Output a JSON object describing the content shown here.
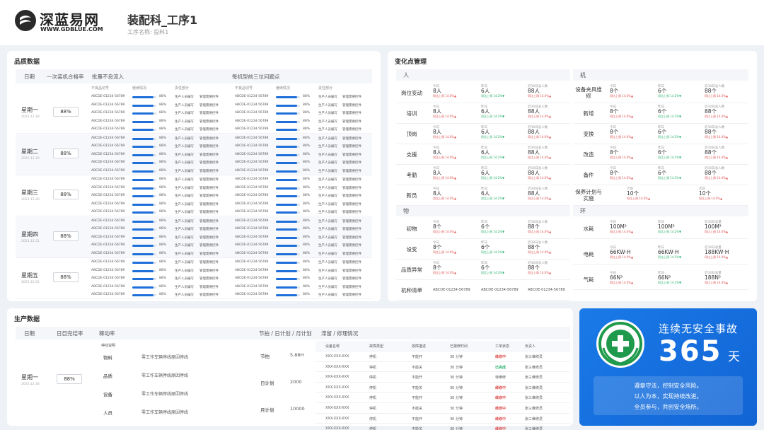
{
  "header": {
    "logo_cn": "深蓝易网",
    "logo_en": "WWW.GDBLUE.COM",
    "title": "装配科_工序1",
    "subtitle": "工序名称: 投料1"
  },
  "quality": {
    "title": "品质数据",
    "headers": [
      "日期",
      "一次装机合格率",
      "批量不良流入",
      "每机型前三位问题点"
    ],
    "subheaders": [
      "不良品切号",
      "继续情况",
      "责任部分",
      "不良品切号",
      "继续情况",
      "责任部分"
    ],
    "code": "ABCDE-01234-56789",
    "pct": "88%",
    "dept": "生产人员编写",
    "reason": "管理需要控件",
    "bar_fraction": 0.88,
    "groups": [
      {
        "day": "星期一",
        "date": "2023.12.18",
        "rate": "88%"
      },
      {
        "day": "星期二",
        "date": "2023.12.19",
        "rate": "88%"
      },
      {
        "day": "星期三",
        "date": "2023.12.20",
        "rate": "88%"
      },
      {
        "day": "星期四",
        "date": "2023.12.21",
        "rate": "88%"
      },
      {
        "day": "星期五",
        "date": "2023.12.22",
        "rate": "88%"
      }
    ]
  },
  "change": {
    "title": "变化点管理",
    "sections": {
      "person": "人",
      "machine": "机",
      "material": "物",
      "env": "环"
    },
    "person_rows": [
      "岗位变动",
      "培训",
      "顶岗",
      "支援",
      "考勤",
      "新员"
    ],
    "machine_rows": [
      "设备夹具维修",
      "新增",
      "变换",
      "改造",
      "备件"
    ],
    "plan_label": "保养计划与实施",
    "material_rows": [
      "初物",
      "设变",
      "品质异常",
      "机种清单"
    ],
    "env_rows": [
      "水耗",
      "电耗",
      "气耗"
    ],
    "lbl_today": "今日",
    "lbl_yesterday": "昨日",
    "lbl_recent": "近30日总人数",
    "lbl_plan": "计划",
    "lbl_done": "实际",
    "lbl_recent_env": "近30日总量",
    "val_person": "8人",
    "val_person_y": "6人",
    "val_person_r": "88人",
    "val_unit": "8个",
    "val_unit_y": "6个",
    "val_unit_r": "88个",
    "val_plan": "10个",
    "val_water": "100M³",
    "val_water_r": "100M³",
    "val_elec": "66KW·H",
    "val_elec_r": "188KW·H",
    "val_gas": "66N³",
    "val_gas_r": "188N³",
    "cmp_up": "同比上周 14.0%▲",
    "cmp_down": "同比上周 14.2%▼",
    "model_code": "ABCDE-01234-56789"
  },
  "production": {
    "title": "生产数据",
    "headers": [
      "日期",
      "日目完结率",
      "稼动率",
      "节拍 / 日计划 / 月计划",
      "滞留 / 修理情况"
    ],
    "day": "星期一",
    "date": "2023.12.18",
    "rate": "88%",
    "oee_title": "停线说明",
    "reasons": [
      "物料",
      "品质",
      "设备",
      "人员"
    ],
    "reason_desc": "零工作车辆停线原因停线",
    "takt_labels": [
      "节拍",
      "日计划",
      "月计划"
    ],
    "takt_values": [
      "5.88H",
      "2000",
      "10000"
    ],
    "repair_headers": [
      "设备名称",
      "故障类型",
      "故障描述",
      "已报修时间",
      "工单状态",
      "负责人"
    ],
    "repair_rows": [
      {
        "name": "XXX-XXX-XXX",
        "type": "停机",
        "desc": "不能开",
        "time": "30 分钟",
        "status": "维修中",
        "owner": "张三维修员",
        "color": "red"
      },
      {
        "name": "XXX-XXX-XXX",
        "type": "停机",
        "desc": "不能关",
        "time": "30 分钟",
        "status": "已完成",
        "owner": "张三维修员",
        "color": "green"
      },
      {
        "name": "XXX-XXX-XXX",
        "type": "停机",
        "desc": "不能开",
        "time": "30 分钟",
        "status": "待维修",
        "owner": "张三维修员",
        "color": "normal"
      },
      {
        "name": "XXX-XXX-XXX",
        "type": "停机",
        "desc": "不能关",
        "time": "30 分钟",
        "status": "维修中",
        "owner": "张三维修员",
        "color": "red"
      },
      {
        "name": "XXX-XXX-XXX",
        "type": "停机",
        "desc": "不能开",
        "time": "30 分钟",
        "status": "维修中",
        "owner": "张三维修员",
        "color": "red"
      },
      {
        "name": "XXX-XXX-XXX",
        "type": "停机",
        "desc": "不能关",
        "time": "30 分钟",
        "status": "维修中",
        "owner": "张三维修员",
        "color": "red"
      },
      {
        "name": "XXX-XXX-XXX",
        "type": "停机",
        "desc": "不能开",
        "time": "30 分钟",
        "status": "维修中",
        "owner": "张三维修员",
        "color": "red"
      },
      {
        "name": "XXX-XXX-XXX",
        "type": "停机",
        "desc": "不能关",
        "time": "30 分钟",
        "status": "维修中",
        "owner": "张三维修员",
        "color": "red"
      }
    ]
  },
  "safety": {
    "title": "连续无安全事故",
    "days": "365",
    "unit": "天",
    "slogans": [
      "遵章守法，控制安全风险。",
      "以人为本，实现持续改进。",
      "全员参与，共创安全场所。"
    ]
  },
  "colors": {
    "accent": "#1e6fd9",
    "up": "#e05555",
    "down": "#2db36f",
    "safety_bg": "#1a7ae8"
  }
}
